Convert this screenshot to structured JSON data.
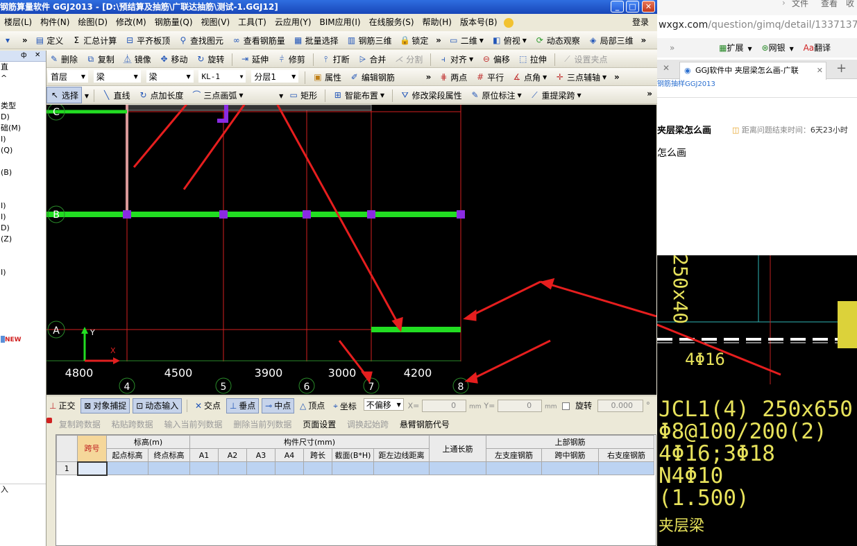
{
  "window": {
    "title": "钢筋算量软件 GGJ2013 - [D:\\预结算及抽筋\\广联达抽筋\\测试-1.GGJ12]",
    "minimize": "_",
    "maximize": "□",
    "close": "✕"
  },
  "menu": [
    "楼层(L)",
    "构件(N)",
    "绘图(D)",
    "修改(M)",
    "钢筋量(Q)",
    "视图(V)",
    "工具(T)",
    "云应用(Y)",
    "BIM应用(I)",
    "在线服务(S)",
    "帮助(H)",
    "版本号(B)"
  ],
  "login": "登录",
  "toolbar1": {
    "items": [
      "定义",
      "汇总计算",
      "平齐板顶",
      "查找图元",
      "查看钢筋量",
      "批量选择",
      "钢筋三维",
      "锁定"
    ],
    "view2d": "二维",
    "view_items": [
      "俯视",
      "动态观察",
      "局部三维"
    ]
  },
  "toolbar2": {
    "items": [
      "删除",
      "复制",
      "镜像",
      "移动",
      "旋转",
      "延伸",
      "修剪",
      "打断",
      "合并"
    ],
    "disabled_items": [
      "分割"
    ],
    "items_after": [
      "对齐",
      "偏移",
      "拉伸"
    ],
    "set_point": "设置夹点"
  },
  "toolbar3": {
    "floor": "首层",
    "type1": "梁",
    "type2": "梁",
    "component": "KL-1",
    "layer": "分层1",
    "attr": "属性",
    "edit_rebar": "编辑钢筋",
    "draw_items": [
      "两点",
      "平行",
      "点角",
      "三点辅轴"
    ]
  },
  "toolbar4": {
    "select": "选择",
    "items": [
      "直线",
      "点加长度",
      "三点画弧"
    ],
    "rect": "矩形",
    "smart": "智能布置",
    "modify_props": "修改梁段属性",
    "origin_mark": "原位标注",
    "re_span": "重提梁跨"
  },
  "leftpanel": {
    "pin": "ф",
    "close": "✕",
    "items": [
      "直",
      "^",
      "",
      "",
      "类型",
      "D)",
      "础(M)",
      "I)",
      "(Q)",
      "",
      "",
      "(B)",
      "",
      "",
      "I)",
      "I)",
      "D)",
      "(Z)",
      "",
      "",
      "I)",
      "",
      "",
      "",
      "",
      "",
      "",
      "",
      "",
      "",
      "",
      "",
      "",
      "",
      "",
      "",
      "",
      "",
      "",
      "",
      "",
      "",
      "入"
    ],
    "new_badge": "NEW"
  },
  "canvas": {
    "axis_rows": [
      "C",
      "B",
      "A"
    ],
    "axis_cols": [
      "4",
      "5",
      "6",
      "7",
      "8"
    ],
    "dims": [
      "4800",
      "4500",
      "3900",
      "3000",
      "4200"
    ],
    "ucs_y": "Y",
    "ucs_x": "X"
  },
  "statusbar": {
    "items": [
      "正交",
      "对象捕捉",
      "动态输入",
      "交点",
      "垂点",
      "中点",
      "顶点",
      "坐标"
    ],
    "offset": "不偏移",
    "x_label": "X=",
    "x_val": "0",
    "y_label": "Y=",
    "y_val": "0",
    "unit": "mm",
    "rotate": "旋转",
    "rot_val": "0.000",
    "deg": "°"
  },
  "tabletoolbar": {
    "disabled": [
      "复制跨数据",
      "粘贴跨数据",
      "输入当前列数据",
      "删除当前列数据"
    ],
    "page_setup": "页面设置",
    "adjust_start": "调换起始跨",
    "cantilever": "悬臂钢筋代号"
  },
  "grid": {
    "h_span": "跨号",
    "h_elev": "标高(m)",
    "h_size": "构件尺寸(mm)",
    "h_top_long": "上通长筋",
    "h_top_rebar": "上部钢筋",
    "sub": [
      "起点标高",
      "终点标高",
      "A1",
      "A2",
      "A3",
      "A4",
      "跨长",
      "截面(B*H)",
      "距左边线距离",
      "左支座钢筋",
      "跨中钢筋",
      "右支座钢筋"
    ],
    "row1": "1"
  },
  "browser": {
    "menu": [
      "文件",
      "查看",
      "收"
    ],
    "url_host": "wxgx.com",
    "url_path": "/question/gimq/detail/1337137.ht",
    "ext_items": [
      "扩展",
      "网银",
      "翻译"
    ],
    "tab_title": "GGJ软件中 夹层梁怎么画-广联",
    "subtitle": "钢筋抽样GGJ2013",
    "question_title": "夹层梁怎么画",
    "remaining_label": "距离问题结束时间：",
    "remaining_value": "6天23小时",
    "question_body": "怎么画"
  },
  "cad2": {
    "vertical_text": "250x40",
    "rebar_small": "4Φ16",
    "lines": [
      "JCL1(4) 250x650",
      "Φ8@100/200(2)",
      "4Φ16;3Φ18",
      "N4Φ10",
      "(1.500)",
      "夹层梁"
    ]
  }
}
